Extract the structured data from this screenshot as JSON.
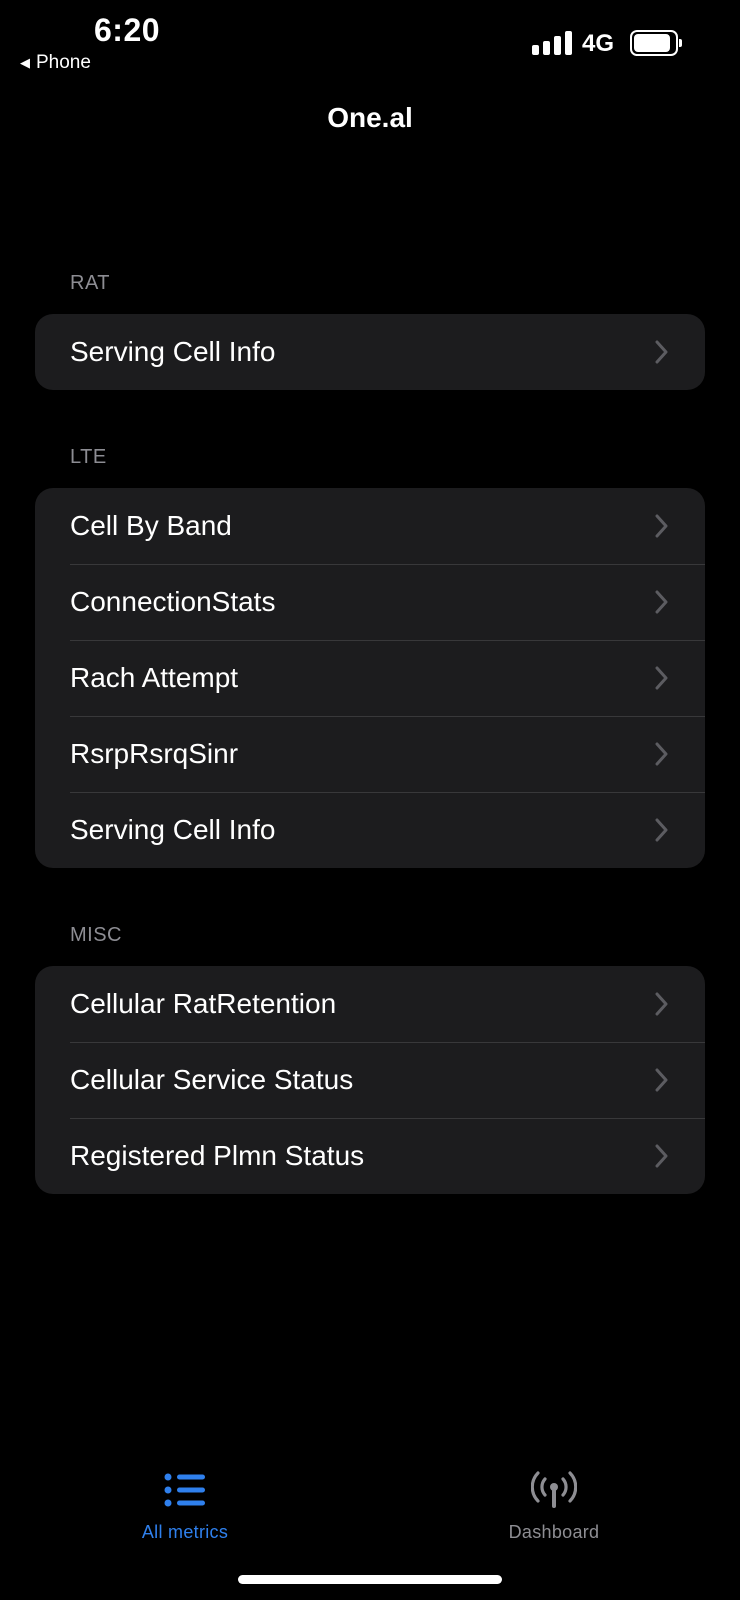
{
  "status_bar": {
    "time": "6:20",
    "back_app": "Phone",
    "network": "4G",
    "signal_bars": 4,
    "battery_level": 0.95
  },
  "nav": {
    "title": "One.al"
  },
  "sections": [
    {
      "header": "RAT",
      "items": [
        "Serving Cell Info"
      ]
    },
    {
      "header": "LTE",
      "items": [
        "Cell By Band",
        "ConnectionStats",
        "Rach Attempt",
        "RsrpRsrqSinr",
        "Serving Cell Info"
      ]
    },
    {
      "header": "MISC",
      "items": [
        "Cellular RatRetention",
        "Cellular Service Status",
        "Registered Plmn Status"
      ]
    }
  ],
  "tabs": [
    {
      "label": "All metrics",
      "icon": "list-icon",
      "selected": true
    },
    {
      "label": "Dashboard",
      "icon": "antenna-icon",
      "selected": false
    }
  ],
  "colors": {
    "background": "#000000",
    "group_background": "#1c1c1e",
    "separator": "#38383a",
    "section_header": "#8d8d93",
    "chevron": "#5c5c61",
    "tab_active": "#2f80ed",
    "tab_inactive": "#8e8e93"
  }
}
